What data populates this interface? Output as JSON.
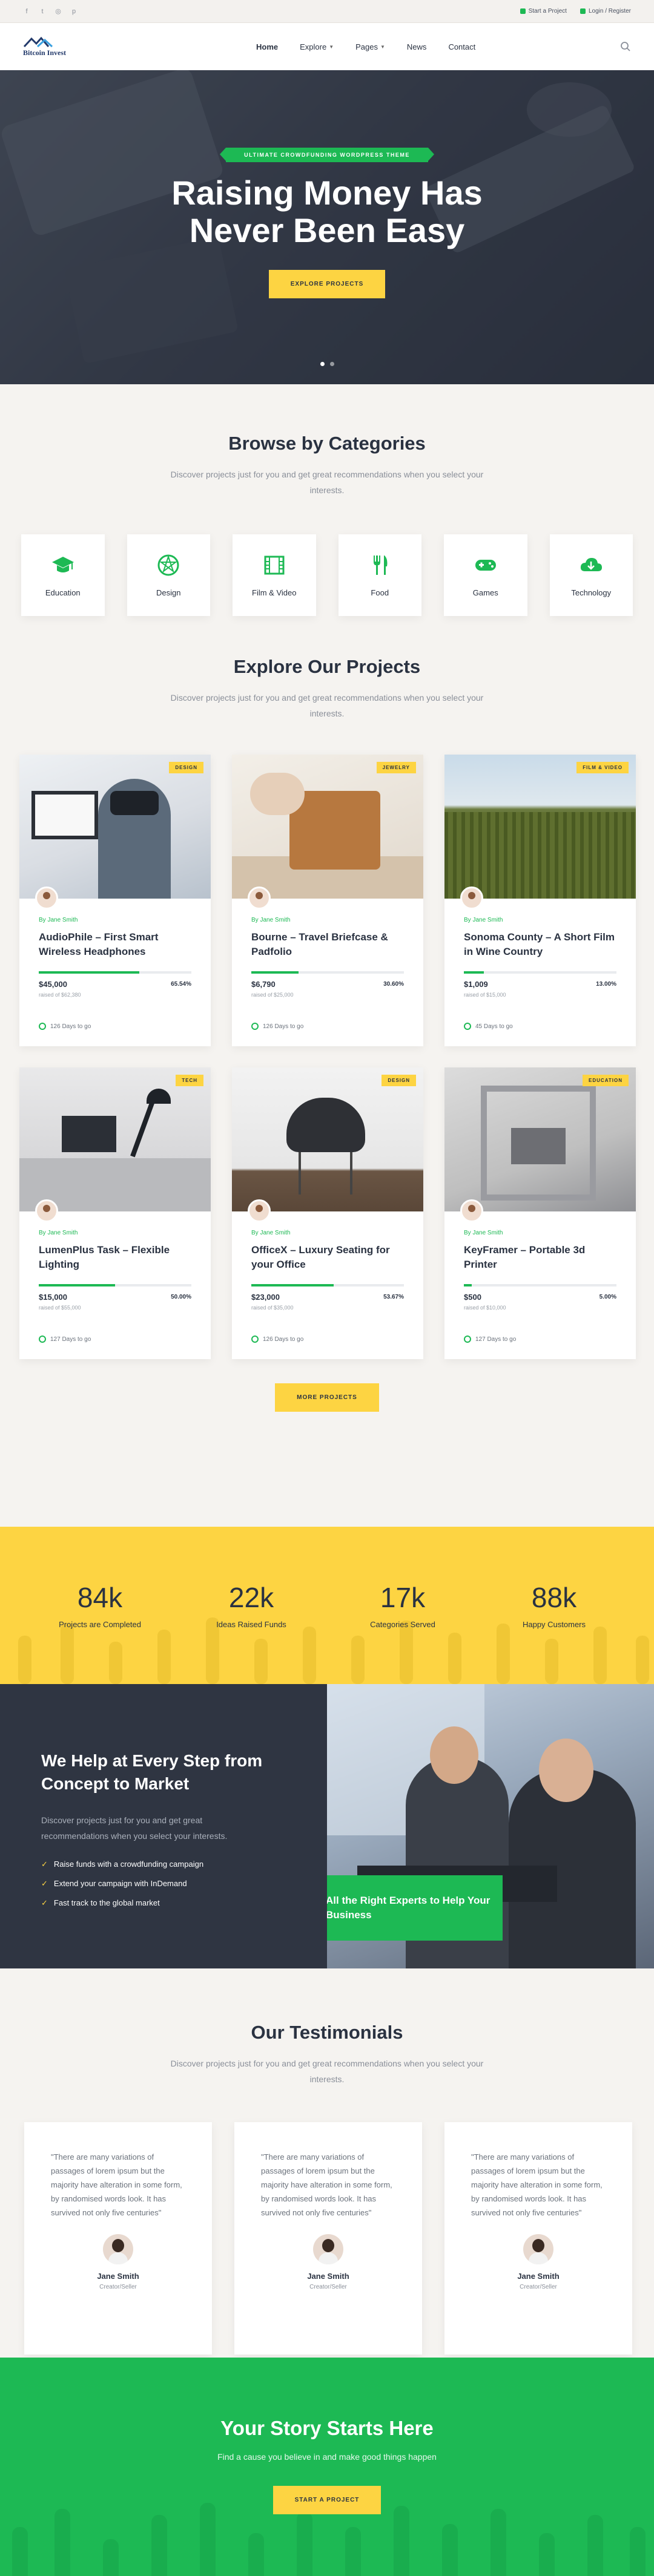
{
  "topbar": {
    "social": [
      "facebook-icon",
      "twitter-icon",
      "instagram-icon",
      "pinterest-icon"
    ],
    "start_project": "Start a Project",
    "login_register": "Login / Register"
  },
  "nav": {
    "logo_text": "Bitcoin Invest",
    "items": [
      {
        "label": "Home",
        "active": true
      },
      {
        "label": "Explore",
        "dropdown": true
      },
      {
        "label": "Pages",
        "dropdown": true
      },
      {
        "label": "News"
      },
      {
        "label": "Contact"
      }
    ]
  },
  "hero": {
    "badge": "ULTIMATE CROWDFUNDING WORDPRESS THEME",
    "title_line1": "Raising Money Has",
    "title_line2": "Never Been Easy",
    "button": "EXPLORE PROJECTS"
  },
  "categories": {
    "title": "Browse by Categories",
    "subtitle": "Discover projects just for you and get great recommendations when you select your interests.",
    "items": [
      {
        "label": "Education",
        "icon": "graduation-cap-icon"
      },
      {
        "label": "Design",
        "icon": "design-icon"
      },
      {
        "label": "Film & Video",
        "icon": "film-icon"
      },
      {
        "label": "Food",
        "icon": "food-icon"
      },
      {
        "label": "Games",
        "icon": "gamepad-icon"
      },
      {
        "label": "Technology",
        "icon": "cloud-icon"
      }
    ]
  },
  "projects": {
    "title": "Explore Our Projects",
    "subtitle": "Discover projects just for you and get great recommendations when you select your interests.",
    "more_button": "MORE PROJECTS",
    "items": [
      {
        "tag": "DESIGN",
        "by": "By Jane Smith",
        "title": "AudioPhile – First Smart Wireless Headphones",
        "raised": "$45,000",
        "goal": "raised of $62,380",
        "pct": "65.54%",
        "progress": 0.66,
        "days": "126 Days to go"
      },
      {
        "tag": "JEWELRY",
        "by": "By Jane Smith",
        "title": "Bourne – Travel Briefcase & Padfolio",
        "raised": "$6,790",
        "goal": "raised of $25,000",
        "pct": "30.60%",
        "progress": 0.31,
        "days": "126 Days to go"
      },
      {
        "tag": "FILM & VIDEO",
        "by": "By Jane Smith",
        "title": "Sonoma County – A Short Film in Wine Country",
        "raised": "$1,009",
        "goal": "raised of $15,000",
        "pct": "13.00%",
        "progress": 0.13,
        "days": "45 Days to go"
      },
      {
        "tag": "TECH",
        "by": "By Jane Smith",
        "title": "LumenPlus Task – Flexible Lighting",
        "raised": "$15,000",
        "goal": "raised of $55,000",
        "pct": "50.00%",
        "progress": 0.5,
        "days": "127 Days to go"
      },
      {
        "tag": "DESIGN",
        "by": "By Jane Smith",
        "title": "OfficeX – Luxury Seating for your Office",
        "raised": "$23,000",
        "goal": "raised of $35,000",
        "pct": "53.67%",
        "progress": 0.54,
        "days": "126 Days to go"
      },
      {
        "tag": "EDUCATION",
        "by": "By Jane Smith",
        "title": "KeyFramer – Portable 3d Printer",
        "raised": "$500",
        "goal": "raised of $10,000",
        "pct": "5.00%",
        "progress": 0.05,
        "days": "127 Days to go"
      }
    ]
  },
  "stats": [
    {
      "n": "84k",
      "l": "Projects are Completed"
    },
    {
      "n": "22k",
      "l": "Ideas Raised Funds"
    },
    {
      "n": "17k",
      "l": "Categories Served"
    },
    {
      "n": "88k",
      "l": "Happy Customers"
    }
  ],
  "help": {
    "title": "We Help at Every Step from Concept to Market",
    "text": "Discover projects just for you and get great recommendations when you select your interests.",
    "list": [
      "Raise funds with a crowdfunding campaign",
      "Extend your campaign with InDemand",
      "Fast track to the global market"
    ],
    "box": "All the Right Experts to Help Your Business"
  },
  "testimonials": {
    "title": "Our Testimonials",
    "subtitle": "Discover projects just for you and get great recommendations when you select your interests.",
    "items": [
      {
        "quote": "\"There are many variations of passages of lorem ipsum but the majority have alteration in some form, by randomised words look. It has survived not only five centuries\"",
        "name": "Jane Smith",
        "role": "Creator/Seller"
      },
      {
        "quote": "\"There are many variations of passages of lorem ipsum but the majority have alteration in some form, by randomised words look. It has survived not only five centuries\"",
        "name": "Jane Smith",
        "role": "Creator/Seller"
      },
      {
        "quote": "\"There are many variations of passages of lorem ipsum but the majority have alteration in some form, by randomised words look. It has survived not only five centuries\"",
        "name": "Jane Smith",
        "role": "Creator/Seller"
      }
    ]
  },
  "story": {
    "title": "Your Story Starts Here",
    "text": "Find a cause you believe in and make good things happen",
    "button": "START A PROJECT"
  },
  "colors": {
    "accent": "#1db954",
    "yellow": "#fdd442",
    "dark": "#2f3542"
  }
}
